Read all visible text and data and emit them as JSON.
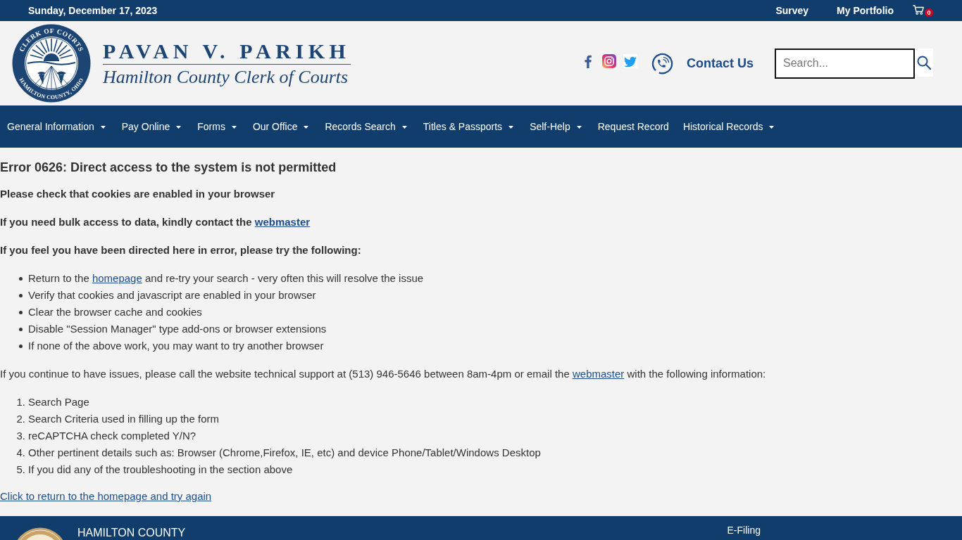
{
  "top_bar": {
    "date": "Sunday, December 17, 2023",
    "links": [
      "Survey",
      "My Portfolio"
    ],
    "cart_count": "0"
  },
  "header": {
    "seal": {
      "top_text": "CLERK OF COURTS",
      "bottom_text": "HAMILTON COUNTY, OHIO"
    },
    "name": "PAVAN V. PARIKH",
    "subtitle": "Hamilton County Clerk of Courts",
    "contact_label": "Contact Us",
    "search": {
      "placeholder": "Search..."
    }
  },
  "nav": [
    {
      "label": "General Information",
      "dropdown": true
    },
    {
      "label": "Pay Online",
      "dropdown": true
    },
    {
      "label": "Forms",
      "dropdown": true
    },
    {
      "label": "Our Office",
      "dropdown": true
    },
    {
      "label": "Records Search",
      "dropdown": true
    },
    {
      "label": "Titles & Passports",
      "dropdown": true
    },
    {
      "label": "Self-Help",
      "dropdown": true
    },
    {
      "label": "Request Record",
      "dropdown": false
    },
    {
      "label": "Historical Records",
      "dropdown": true
    }
  ],
  "content": {
    "heading": "Error 0626: Direct access to the system is not permitted",
    "intro": [
      {
        "text": "Please check that cookies are enabled in your browser"
      },
      {
        "text": "If you need bulk access to data, kindly contact the ",
        "link": "webmaster"
      },
      {
        "text": "If you feel you have been directed here in error, please try the following:"
      }
    ],
    "tips": [
      {
        "text": "Return to the ",
        "link": "homepage",
        "text_after": " and re-try your search - very often this will resolve the issue"
      },
      {
        "text": "Verify that cookies and javascript are enabled in your browser"
      },
      {
        "text": "Clear the browser cache and cookies"
      },
      {
        "text": "Disable \"Session Manager\" type add-ons or browser extensions"
      },
      {
        "text": "If none of the above work, you may want to try another browser"
      }
    ],
    "support": {
      "text": "If you continue to have issues, please call the website technical support at (513) 946-5646 between 8am-4pm or email the ",
      "link": "webmaster",
      "text_after": " with the following information:"
    },
    "info_items": [
      {
        "number": "1.",
        "text": "Search Page"
      },
      {
        "number": "2.",
        "text": "Search Criteria used in filling up the form"
      },
      {
        "number": "3.",
        "text": "reCAPTCHA check completed Y/N?"
      },
      {
        "number": "4.",
        "text": "Other pertinent details such as: Browser (Chrome,Firefox, IE, etc) and device Phone/Tablet/Windows Desktop"
      },
      {
        "number": "5.",
        "text": "If you did any of the troubleshooting in the section above"
      }
    ],
    "return_link": "Click to return to the homepage and try again"
  },
  "footer": {
    "title": "HAMILTON COUNTY",
    "links": [
      "E-Filing"
    ]
  }
}
